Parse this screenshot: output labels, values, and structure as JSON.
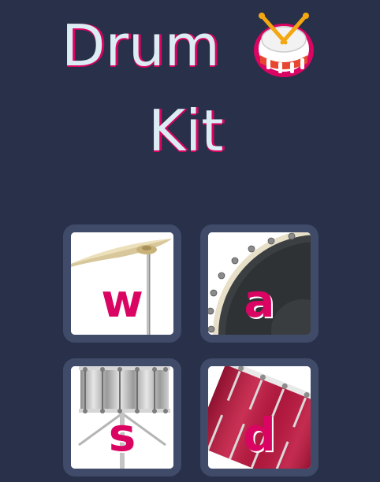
{
  "title": {
    "line1": "Drum",
    "line2": "Kit",
    "logo_icon": "drum-emoji-icon"
  },
  "colors": {
    "background": "#283149",
    "title_text": "#dbedf3",
    "accent": "#da0463",
    "button_border": "#404b69"
  },
  "drums": [
    {
      "key": "w",
      "image": "crash-cymbal-icon"
    },
    {
      "key": "a",
      "image": "kick-drum-icon"
    },
    {
      "key": "s",
      "image": "snare-drum-icon"
    },
    {
      "key": "d",
      "image": "tom-drum-icon"
    }
  ]
}
